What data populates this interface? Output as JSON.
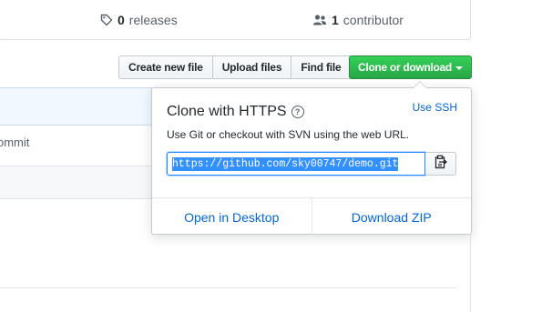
{
  "stats": {
    "releases_count": "0",
    "releases_label": "releases",
    "contributors_count": "1",
    "contributors_label": "contributor"
  },
  "toolbar": {
    "create_file": "Create new file",
    "upload_files": "Upload files",
    "find_file": "Find file",
    "clone_download": "Clone or download"
  },
  "background": {
    "commit_fragment": "ommit"
  },
  "clone_popover": {
    "title": "Clone with HTTPS",
    "help_glyph": "?",
    "use_ssh": "Use SSH",
    "description": "Use Git or checkout with SVN using the web URL.",
    "url": "https://github.com/sky00747/demo.git",
    "open_desktop": "Open in Desktop",
    "download_zip": "Download ZIP"
  },
  "colors": {
    "primary_button": "#28a745",
    "link": "#0366d6",
    "selection": "#3390ff"
  },
  "icons": [
    "tag-icon",
    "people-icon",
    "caret-down-icon",
    "question-icon",
    "clipboard-icon"
  ]
}
